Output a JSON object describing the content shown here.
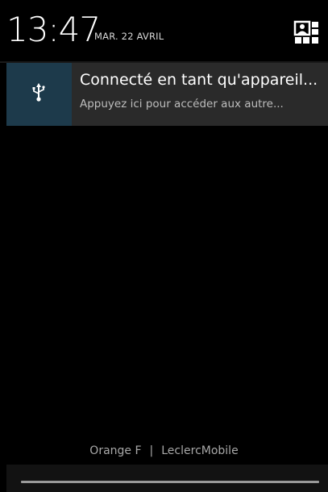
{
  "status": {
    "time": "13:47",
    "date": "MAR. 22 AVRIL"
  },
  "quick_settings": {
    "icon": "quick-settings-icon"
  },
  "notification": {
    "icon": "usb-icon",
    "title": "Connecté en tant qu'appareil...",
    "text": "Appuyez ici pour accéder aux autre..."
  },
  "carrier": {
    "left": "Orange F",
    "separator": "|",
    "right": "LeclercMobile"
  },
  "colors": {
    "background": "#000000",
    "notification_bg": "#2a2a2a",
    "icon_bg": "#1d3a4b"
  }
}
